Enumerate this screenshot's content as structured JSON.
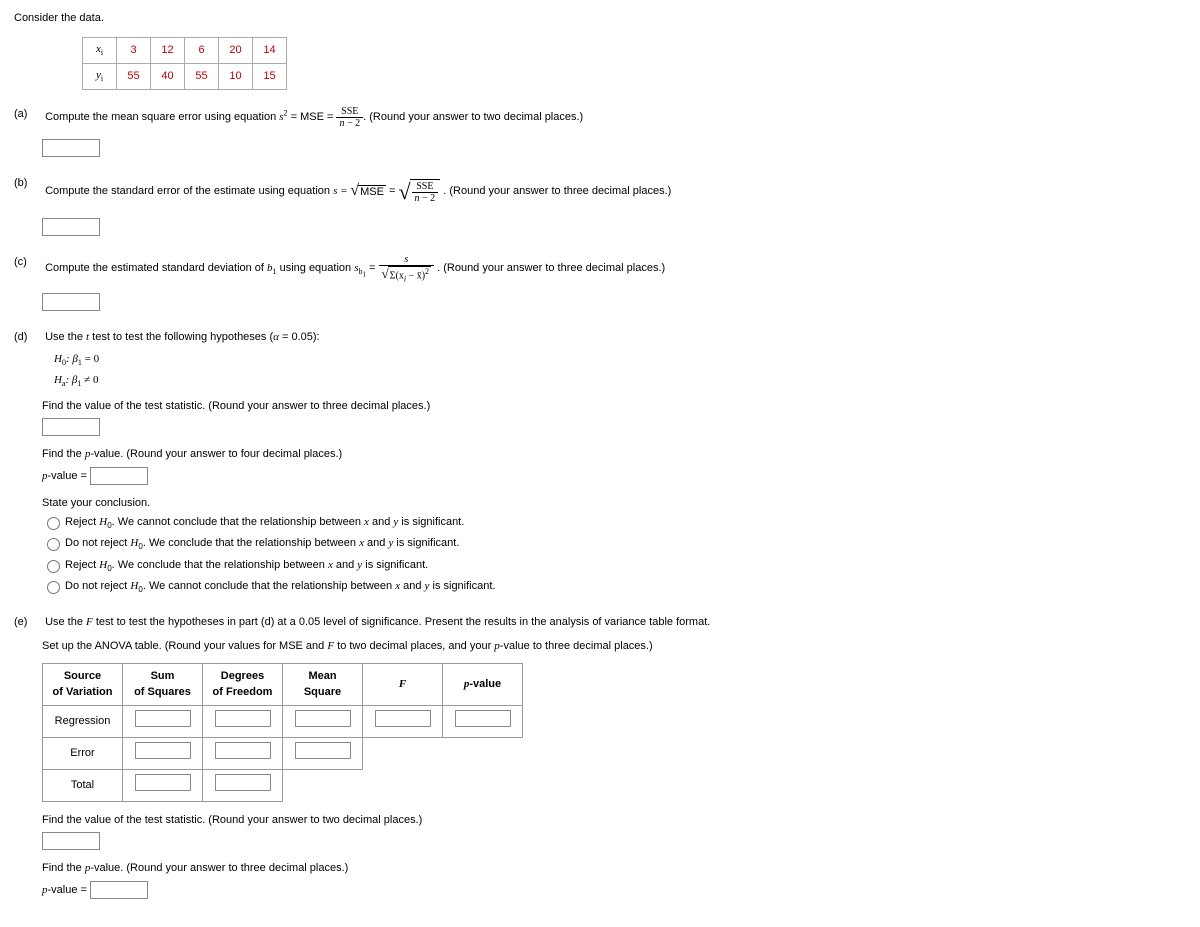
{
  "intro": "Consider the data.",
  "table": {
    "hdr_x": "x",
    "hdr_y": "y",
    "hdr_sub": "i",
    "x": [
      "3",
      "12",
      "6",
      "20",
      "14"
    ],
    "y": [
      "55",
      "40",
      "55",
      "10",
      "15"
    ]
  },
  "a": {
    "label": "(a)",
    "text_pre": "Compute the mean square error using equation ",
    "eq_lhs": "s",
    "eq_sup": "2",
    "eq_eq1": " = MSE = ",
    "frac_num": "SSE",
    "frac_den": "n − 2",
    "text_post": ". (Round your answer to two decimal places.)"
  },
  "b": {
    "label": "(b)",
    "text_pre": "Compute the standard error of the estimate using equation ",
    "eq_s": "s = ",
    "mse": "MSE",
    "eq_eq2": " = ",
    "frac_num": "SSE",
    "frac_den": "n − 2",
    "text_post": ". (Round your answer to three decimal places.)"
  },
  "c": {
    "label": "(c)",
    "text_pre": "Compute the estimated standard deviation of ",
    "b1": "b",
    "b1_sub": "1",
    "text_mid": " using equation ",
    "sb": "s",
    "sb_sub": "b",
    "sb_sub2": "1",
    "eq": " = ",
    "frac_num": "s",
    "den_sigma": "Σ(x",
    "den_sub": "i",
    "den_mid": " − x̄)",
    "den_sup": "2",
    "text_post": ". (Round your answer to three decimal places.)"
  },
  "d": {
    "label": "(d)",
    "text1": "Use the t test to test the following hypotheses (α = 0.05):",
    "h0": "H",
    "h0_sub": "0",
    "h0_colon": ": β",
    "h0_beta_sub": "1",
    "h0_eq": " = 0",
    "ha": "H",
    "ha_sub": "a",
    "ha_colon": ": β",
    "ha_beta_sub": "1",
    "ha_ne": " ≠ 0",
    "find_ts": "Find the value of the test statistic. (Round your answer to three decimal places.)",
    "find_pv": "Find the p-value. (Round your answer to four decimal places.)",
    "pval_lbl": "p-value = ",
    "state": "State your conclusion.",
    "r1": "Reject H₀. We cannot conclude that the relationship between x and y is significant.",
    "r2": "Do not reject H₀. We conclude that the relationship between x and y is significant.",
    "r3": "Reject H₀. We conclude that the relationship between x and y is significant.",
    "r4": "Do not reject H₀. We cannot conclude that the relationship between x and y is significant."
  },
  "e": {
    "label": "(e)",
    "text1": "Use the F test to test the hypotheses in part (d) at a 0.05 level of significance. Present the results in the analysis of variance table format.",
    "text2": "Set up the ANOVA table. (Round your values for MSE and F to two decimal places, and your p-value to three decimal places.)",
    "th1": "Source\nof Variation",
    "th2": "Sum\nof Squares",
    "th3": "Degrees\nof Freedom",
    "th4": "Mean\nSquare",
    "th5": "F",
    "th6": "p-value",
    "row1": "Regression",
    "row2": "Error",
    "row3": "Total",
    "find_ts": "Find the value of the test statistic. (Round your answer to two decimal places.)",
    "find_pv": "Find the p-value. (Round your answer to three decimal places.)",
    "pval_lbl": "p-value = "
  }
}
